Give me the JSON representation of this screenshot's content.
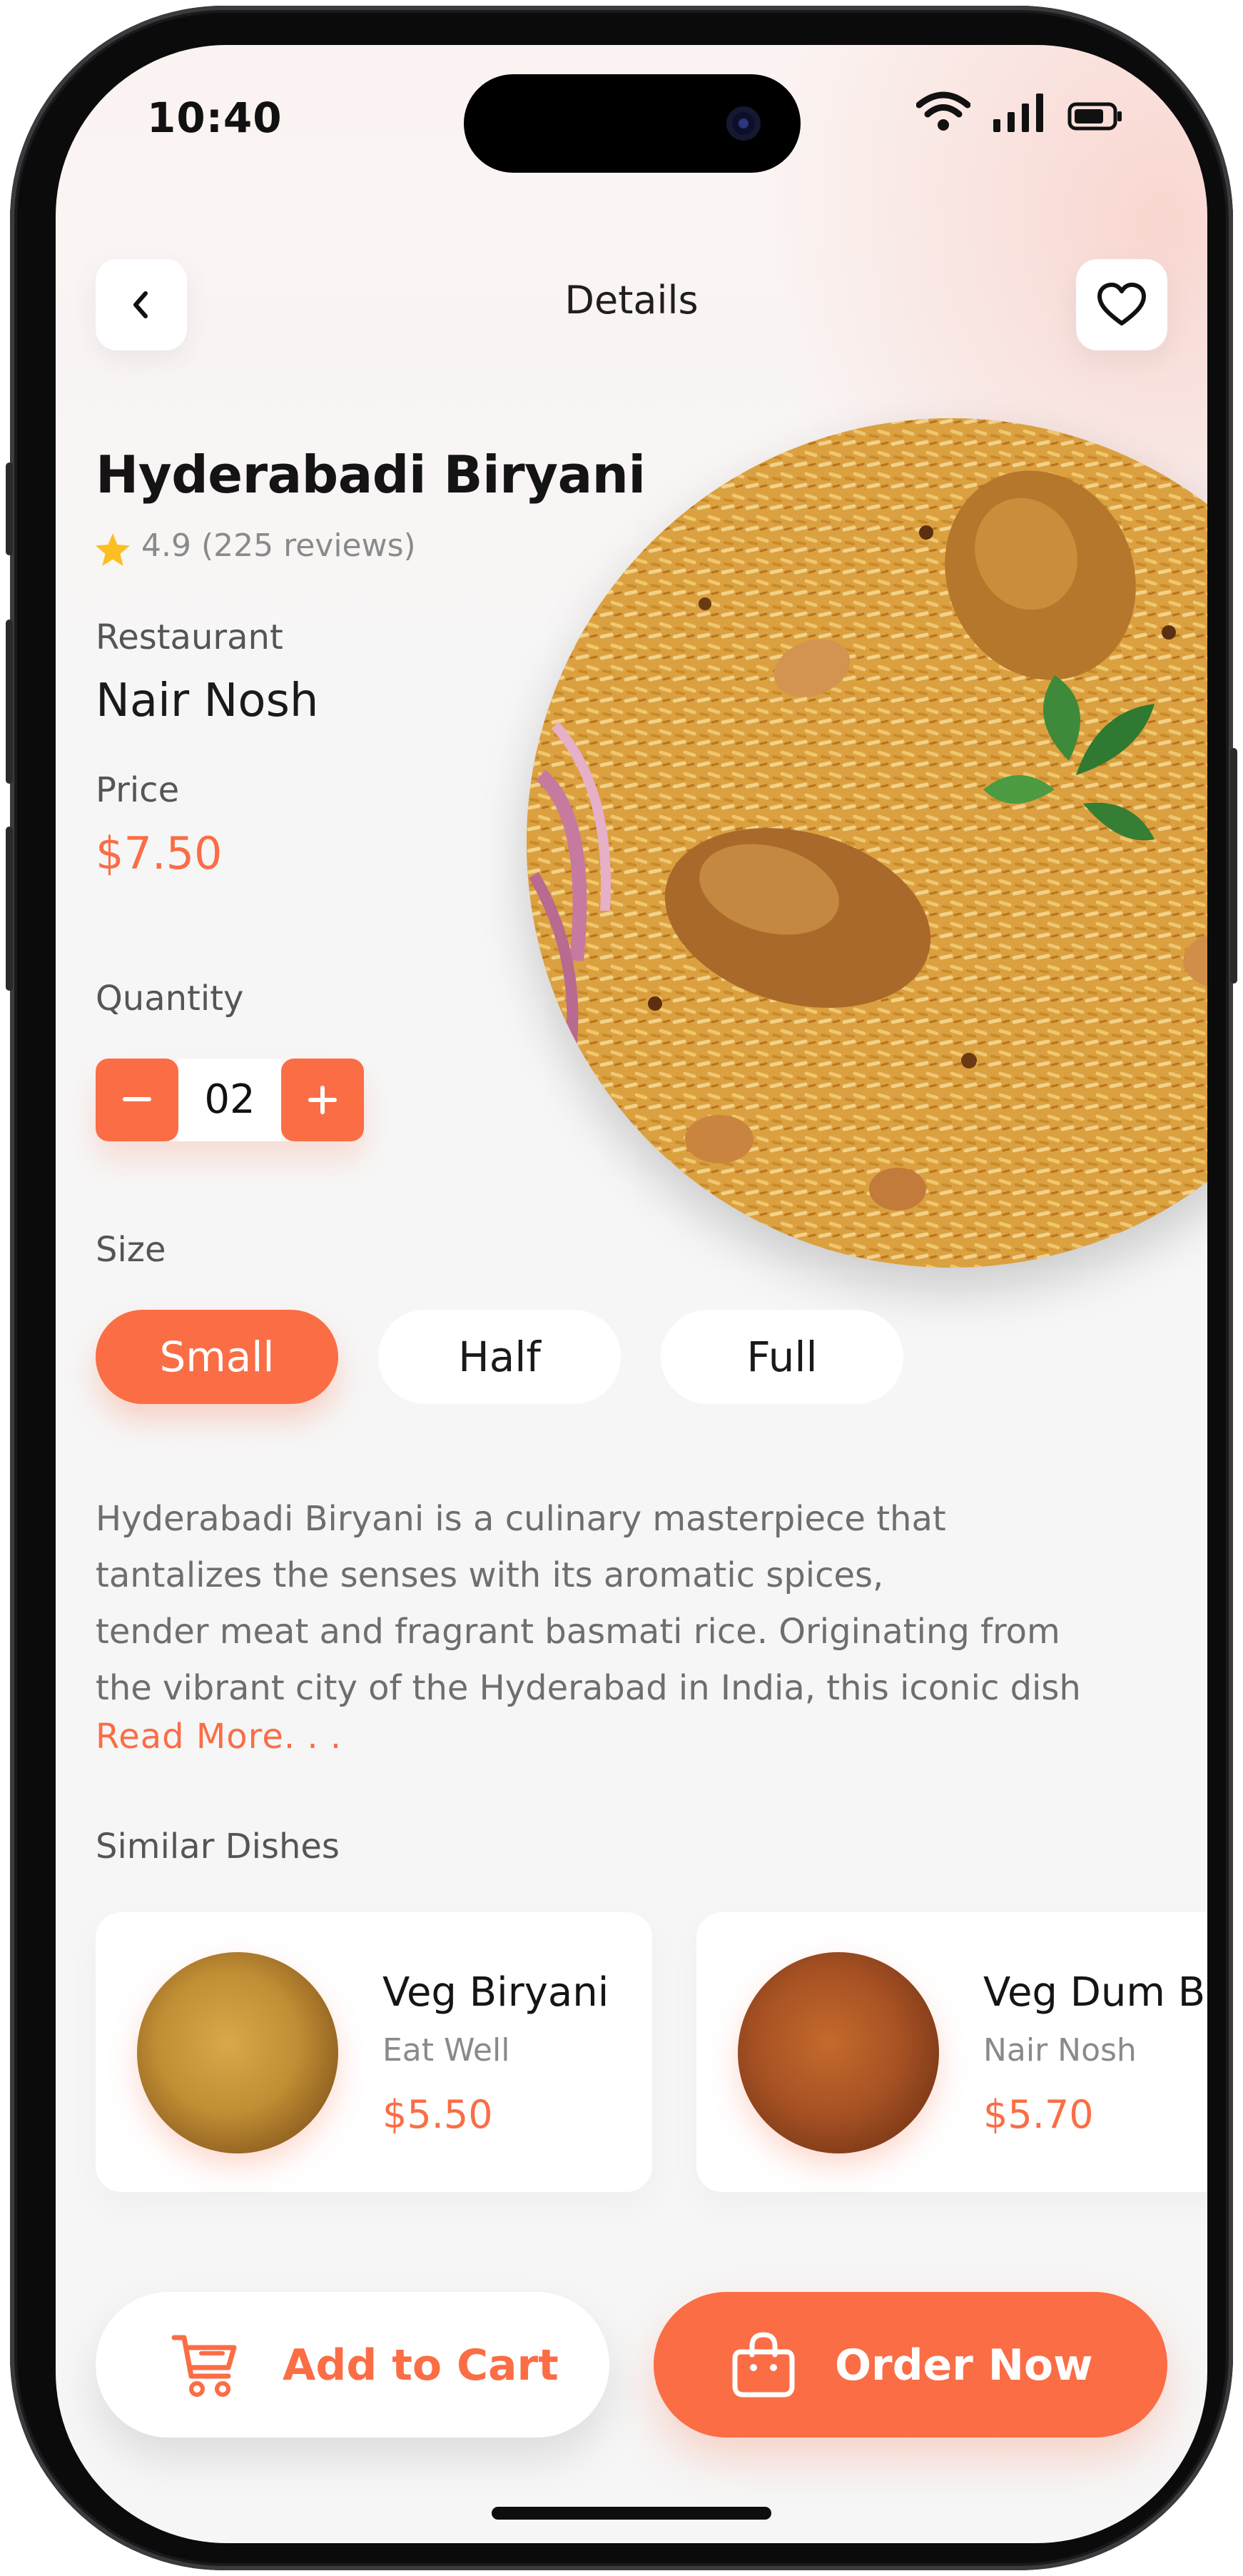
{
  "status_bar": {
    "time": "10:40"
  },
  "header": {
    "title": "Details"
  },
  "dish": {
    "name": "Hyderabadi Biryani",
    "rating": "4.9 (225 reviews)",
    "restaurant_label": "Restaurant",
    "restaurant_name": "Nair Nosh",
    "price_label": "Price",
    "price": "$7.50"
  },
  "quantity": {
    "label": "Quantity",
    "value": "02"
  },
  "size": {
    "label": "Size",
    "options": [
      "Small",
      "Half",
      "Full"
    ],
    "selected": "Small"
  },
  "description": {
    "lines": [
      "Hyderabadi Biryani is a culinary masterpiece that",
      "tantalizes the senses with its aromatic spices,",
      "tender meat and fragrant basmati rice. Originating from",
      "the vibrant city of the Hyderabad in India, this iconic dish"
    ],
    "read_more": "Read More. . ."
  },
  "similar": {
    "title": "Similar Dishes",
    "items": [
      {
        "name": "Veg Biryani",
        "restaurant": "Eat Well",
        "price": "$5.50"
      },
      {
        "name": "Veg Dum Bi",
        "restaurant": "Nair Nosh",
        "price": "$5.70"
      }
    ]
  },
  "actions": {
    "add_to_cart": "Add to Cart",
    "order_now": "Order Now"
  },
  "colors": {
    "accent": "#fb6d45",
    "rating_star": "#fbbf24"
  }
}
